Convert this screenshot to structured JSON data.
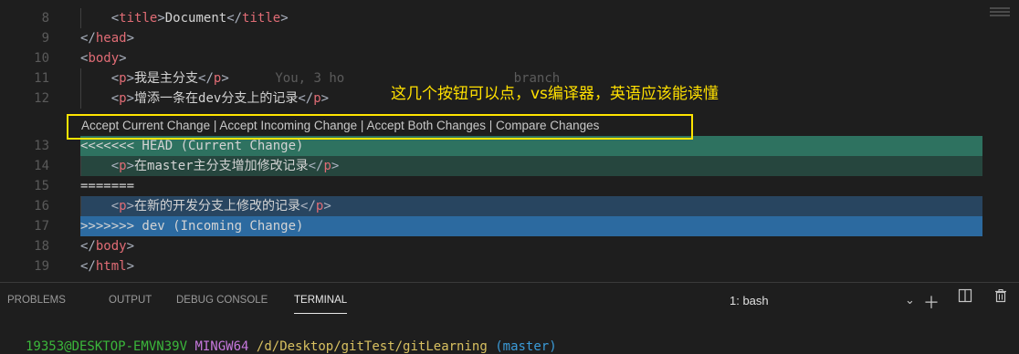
{
  "editor": {
    "lines": [
      {
        "num": "8",
        "indent": "    ",
        "parts": [
          {
            "c": "b",
            "t": "<"
          },
          {
            "c": "t",
            "t": "title"
          },
          {
            "c": "b",
            "t": ">"
          },
          {
            "c": "tx",
            "t": "Document"
          },
          {
            "c": "b",
            "t": "</"
          },
          {
            "c": "t",
            "t": "title"
          },
          {
            "c": "b",
            "t": ">"
          }
        ]
      },
      {
        "num": "9",
        "indent": "",
        "parts": [
          {
            "c": "b",
            "t": "</"
          },
          {
            "c": "t",
            "t": "head"
          },
          {
            "c": "b",
            "t": ">"
          }
        ]
      },
      {
        "num": "10",
        "indent": "",
        "parts": [
          {
            "c": "b",
            "t": "<"
          },
          {
            "c": "t",
            "t": "body"
          },
          {
            "c": "b",
            "t": ">"
          }
        ]
      },
      {
        "num": "11",
        "indent": "    ",
        "parts": [
          {
            "c": "b",
            "t": "<"
          },
          {
            "c": "t",
            "t": "p"
          },
          {
            "c": "b",
            "t": ">"
          },
          {
            "c": "tx",
            "t": "我是主分支"
          },
          {
            "c": "b",
            "t": "</"
          },
          {
            "c": "t",
            "t": "p"
          },
          {
            "c": "b",
            "t": ">"
          },
          {
            "c": "blame",
            "t": "      You, 3 ho                      branch"
          }
        ]
      },
      {
        "num": "12",
        "indent": "    ",
        "parts": [
          {
            "c": "b",
            "t": "<"
          },
          {
            "c": "t",
            "t": "p"
          },
          {
            "c": "b",
            "t": ">"
          },
          {
            "c": "tx",
            "t": "增添一条在dev分支上的记录"
          },
          {
            "c": "b",
            "t": "</"
          },
          {
            "c": "t",
            "t": "p"
          },
          {
            "c": "b",
            "t": ">"
          }
        ]
      },
      {
        "num": "13",
        "indent": "",
        "parts": [
          {
            "c": "tx",
            "t": "<<<<<<< HEAD (Current Change)"
          }
        ]
      },
      {
        "num": "14",
        "indent": "    ",
        "parts": [
          {
            "c": "b",
            "t": "<"
          },
          {
            "c": "t",
            "t": "p"
          },
          {
            "c": "b",
            "t": ">"
          },
          {
            "c": "tx",
            "t": "在master主分支增加修改记录"
          },
          {
            "c": "b",
            "t": "</"
          },
          {
            "c": "t",
            "t": "p"
          },
          {
            "c": "b",
            "t": ">"
          }
        ]
      },
      {
        "num": "15",
        "indent": "",
        "parts": [
          {
            "c": "tx",
            "t": "======="
          }
        ]
      },
      {
        "num": "16",
        "indent": "    ",
        "parts": [
          {
            "c": "b",
            "t": "<"
          },
          {
            "c": "t",
            "t": "p"
          },
          {
            "c": "b",
            "t": ">"
          },
          {
            "c": "tx",
            "t": "在新的开发分支上修改的记录"
          },
          {
            "c": "b",
            "t": "</"
          },
          {
            "c": "t",
            "t": "p"
          },
          {
            "c": "b",
            "t": ">"
          }
        ]
      },
      {
        "num": "17",
        "indent": "",
        "parts": [
          {
            "c": "tx",
            "t": ">>>>>>> dev (Incoming Change)"
          }
        ]
      },
      {
        "num": "18",
        "indent": "",
        "parts": [
          {
            "c": "b",
            "t": "</"
          },
          {
            "c": "t",
            "t": "body"
          },
          {
            "c": "b",
            "t": ">"
          }
        ]
      },
      {
        "num": "19",
        "indent": "",
        "parts": [
          {
            "c": "b",
            "t": "</"
          },
          {
            "c": "t",
            "t": "html"
          },
          {
            "c": "b",
            "t": ">"
          }
        ]
      }
    ],
    "codelens": "Accept Current Change | Accept Incoming Change | Accept Both Changes | Compare Changes",
    "annotation": "这几个按钮可以点，vs编译器，英语应该能读懂"
  },
  "panel": {
    "tabs": [
      "PROBLEMS",
      "OUTPUT",
      "DEBUG CONSOLE",
      "TERMINAL"
    ],
    "terminal_select": "1: bash",
    "icons": [
      "chevron-down-icon",
      "plus-icon",
      "split-icon",
      "trash-icon"
    ],
    "prompt": {
      "user": "19353@DESKTOP-EMVN39V",
      "env": "MINGW64",
      "path": "/d/Desktop/gitTest/gitLearning",
      "branch": "(master)"
    }
  }
}
